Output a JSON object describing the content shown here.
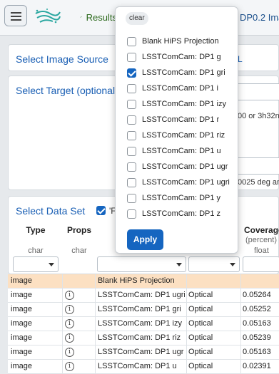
{
  "header": {
    "results_tab_label": "Results",
    "dp_tab_label": "DP0.2 Ima"
  },
  "image_source": {
    "title": "Select Image Source",
    "fragment": "L"
  },
  "target": {
    "title": "Select Target (optional)",
    "fragment_a": "00  or  3h32n",
    "fragment_b": "0025 deg an"
  },
  "data_set": {
    "title": "Select Data Set",
    "checkbox_fragment": "'F",
    "columns": [
      {
        "title": "Type",
        "subtitle": "char"
      },
      {
        "title": "Props",
        "subtitle": "char"
      },
      {
        "title": "Coverage",
        "subtitle": "(percent)",
        "unit": "float"
      }
    ],
    "rows": [
      {
        "type": "image",
        "props": "",
        "name": "Blank HiPS Projection",
        "band": "",
        "coverage": "",
        "selected": true
      },
      {
        "type": "image",
        "props": "i",
        "name": "LSSTComCam: DP1 ugri",
        "band": "Optical",
        "coverage": "0.05264"
      },
      {
        "type": "image",
        "props": "i",
        "name": "LSSTComCam: DP1 gri",
        "band": "Optical",
        "coverage": "0.05252"
      },
      {
        "type": "image",
        "props": "i",
        "name": "LSSTComCam: DP1 izy",
        "band": "Optical",
        "coverage": "0.05163"
      },
      {
        "type": "image",
        "props": "i",
        "name": "LSSTComCam: DP1 riz",
        "band": "Optical",
        "coverage": "0.05239"
      },
      {
        "type": "image",
        "props": "i",
        "name": "LSSTComCam: DP1 ugr",
        "band": "Optical",
        "coverage": "0.05163"
      },
      {
        "type": "image",
        "props": "i",
        "name": "LSSTComCam: DP1 u",
        "band": "Optical",
        "coverage": "0.02391"
      }
    ]
  },
  "popup": {
    "clear_label": "clear",
    "apply_label": "Apply",
    "options": [
      {
        "label": "Blank HiPS Projection",
        "checked": false
      },
      {
        "label": "LSSTComCam: DP1 g",
        "checked": false
      },
      {
        "label": "LSSTComCam: DP1 gri",
        "checked": true
      },
      {
        "label": "LSSTComCam: DP1 i",
        "checked": false
      },
      {
        "label": "LSSTComCam: DP1 izy",
        "checked": false
      },
      {
        "label": "LSSTComCam: DP1 r",
        "checked": false
      },
      {
        "label": "LSSTComCam: DP1 riz",
        "checked": false
      },
      {
        "label": "LSSTComCam: DP1 u",
        "checked": false
      },
      {
        "label": "LSSTComCam: DP1 ugr",
        "checked": false
      },
      {
        "label": "LSSTComCam: DP1 ugri",
        "checked": false
      },
      {
        "label": "LSSTComCam: DP1 y",
        "checked": false
      },
      {
        "label": "LSSTComCam: DP1 z",
        "checked": false
      }
    ]
  },
  "colors": {
    "accent": "#1565c0",
    "title_blue": "#1a5fb4",
    "selected_row": "#fce0c2",
    "results_green": "#2e6b1f"
  }
}
